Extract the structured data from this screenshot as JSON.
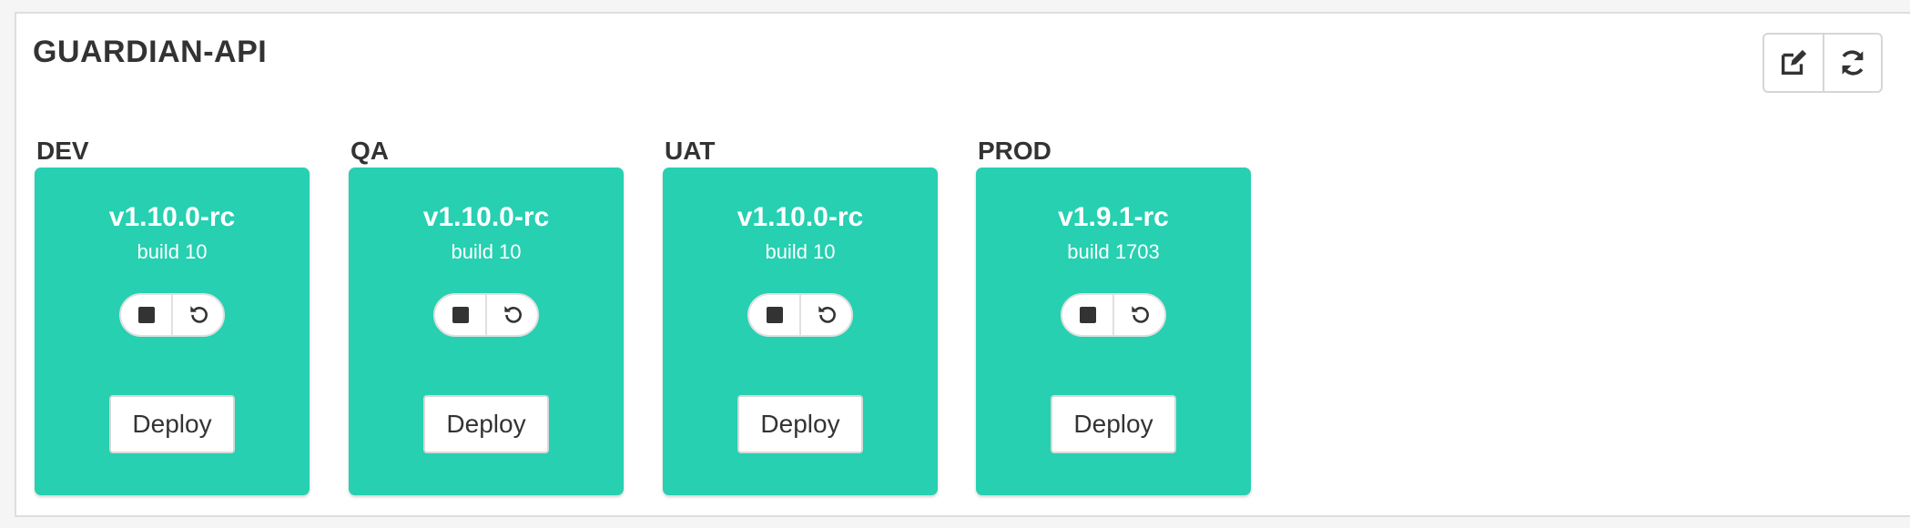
{
  "service": {
    "title": "GUARDIAN-API"
  },
  "toolbar": {
    "edit_icon": "edit-icon",
    "refresh_icon": "refresh-icon"
  },
  "environments": [
    {
      "label": "DEV",
      "version": "v1.10.0-rc",
      "build": "build 10",
      "deploy_label": "Deploy"
    },
    {
      "label": "QA",
      "version": "v1.10.0-rc",
      "build": "build 10",
      "deploy_label": "Deploy"
    },
    {
      "label": "UAT",
      "version": "v1.10.0-rc",
      "build": "build 10",
      "deploy_label": "Deploy"
    },
    {
      "label": "PROD",
      "version": "v1.9.1-rc",
      "build": "build 1703",
      "deploy_label": "Deploy"
    }
  ],
  "colors": {
    "card": "#26d0b1",
    "text": "#333333"
  }
}
